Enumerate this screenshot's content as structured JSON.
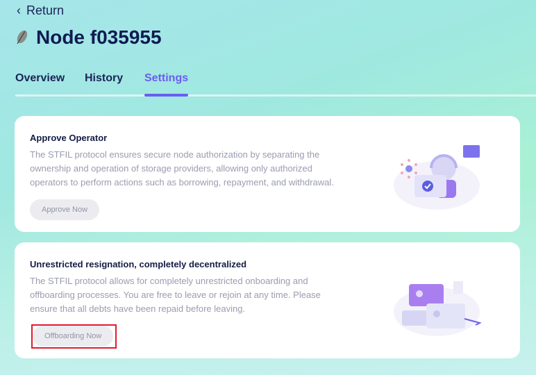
{
  "nav": {
    "return_label": "Return"
  },
  "header": {
    "title": "Node f035955",
    "icon": "leaf-icon"
  },
  "tabs": [
    {
      "label": "Overview"
    },
    {
      "label": "History"
    },
    {
      "label": "Settings",
      "active": true
    }
  ],
  "cards": [
    {
      "title": "Approve Operator",
      "body": "The STFIL protocol ensures secure node authorization by separating the ownership and operation of storage providers, allowing only authorized operators to perform actions such as borrowing, repayment, and withdrawal.",
      "button": "Approve Now"
    },
    {
      "title": "Unrestricted resignation, completely decentralized",
      "body": "The STFIL protocol allows for completely unrestricted onboarding and offboarding processes. You are free to leave or rejoin at any time. Please ensure that all debts have been repaid before leaving.",
      "button": "Offboarding Now"
    }
  ],
  "colors": {
    "accent": "#6c5cf0",
    "highlight": "#e01c2c"
  }
}
